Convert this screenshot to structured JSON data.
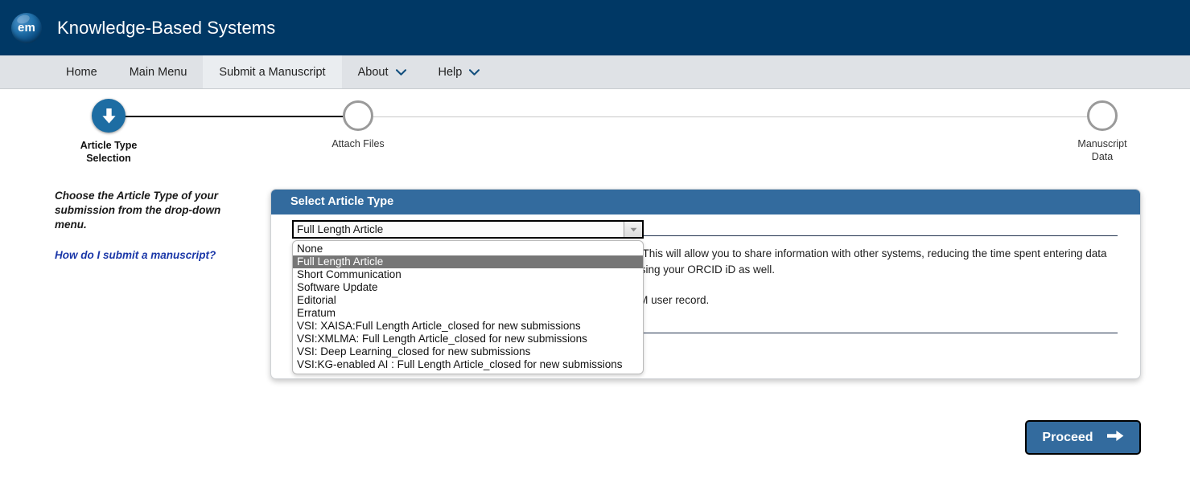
{
  "header": {
    "logo_text": "em",
    "logo_icon": "em-sphere-logo",
    "journal_title": "Knowledge-Based Systems"
  },
  "nav": {
    "items": [
      {
        "label": "Home",
        "active": false,
        "has_caret": false
      },
      {
        "label": "Main Menu",
        "active": false,
        "has_caret": false
      },
      {
        "label": "Submit a Manuscript",
        "active": true,
        "has_caret": false
      },
      {
        "label": "About",
        "active": false,
        "has_caret": true
      },
      {
        "label": "Help",
        "active": false,
        "has_caret": true
      }
    ]
  },
  "stepper": {
    "steps": [
      {
        "label": "Article Type\nSelection",
        "state": "current",
        "icon": "arrow-down-icon"
      },
      {
        "label": "Attach Files",
        "state": "upcoming",
        "icon": ""
      },
      {
        "label": "Manuscript\nData",
        "state": "upcoming",
        "icon": ""
      }
    ]
  },
  "left_column": {
    "instruction": "Choose the Article Type of your submission from the drop-down menu.",
    "help_link": "How do I submit a manuscript?"
  },
  "panel": {
    "title": "Select Article Type",
    "select": {
      "value": "Full Length Article",
      "expanded": true,
      "options": [
        "None",
        "Full Length Article",
        "Short Communication",
        "Software Update",
        "Editorial",
        "Erratum",
        "VSI: XAISA:Full Length Article_closed for new submissions",
        "VSI:XMLMA: Full Length Article_closed for new submissions",
        "VSI: Deep Learning_closed for new submissions",
        "VSI:KG-enabled AI : Full Length Article_closed for new submissions"
      ],
      "selected_index": 1
    },
    "orcid_paragraph_1": "If you do not have an ORCID iD, you can create one and authenticate it. This will allow you to share information with other systems, reducing the time spent entering data and the risk of errors. Once authenticated, you can login to this journal using your ORCID iD as well.",
    "orcid_paragraph_2": "Click the button below to create or associate your ORCID iD with your EM user record."
  },
  "footer": {
    "proceed_label": "Proceed",
    "proceed_icon": "arrow-right-icon"
  },
  "colors": {
    "masthead": "#003865",
    "nav_bg": "#dfe2e6",
    "panel_header": "#336b9e",
    "accent_link": "#1a37a8",
    "step_current": "#1d6da3",
    "option_highlight": "#767676"
  }
}
